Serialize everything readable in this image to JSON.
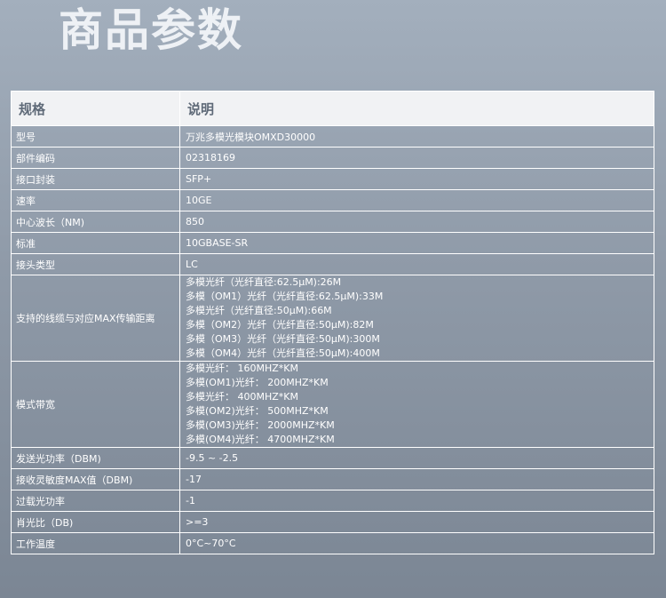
{
  "page_title": "商品参数",
  "table": {
    "headers": [
      "规格",
      "说明"
    ],
    "rows": [
      {
        "label": "型号",
        "value": "万兆多模光模块OMXD30000"
      },
      {
        "label": "部件编码",
        "value": "02318169"
      },
      {
        "label": "接口封装",
        "value": "SFP+"
      },
      {
        "label": "速率",
        "value": "10GE"
      },
      {
        "label": "中心波长（NM)",
        "value": "850"
      },
      {
        "label": "标准",
        "value": "10GBASE-SR"
      },
      {
        "label": "接头类型",
        "value": "LC"
      },
      {
        "label": "支持的线缆与对应MAX传输距离",
        "lines": [
          "多模光纤（光纤直径:62.5μM):26M",
          "多模（OM1）光纤（光纤直径:62.5μM):33M",
          "多模光纤（光纤直径:50μM):66M",
          "多模（OM2）光纤（光纤直径:50μM):82M",
          "多模（OM3）光纤（光纤直径:50μM):300M",
          "多模（OM4）光纤（光纤直径:50μM):400M"
        ]
      },
      {
        "label": "模式带宽",
        "lines": [
          "多模光纤： 160MHZ*KM",
          "多模(OM1)光纤： 200MHZ*KM",
          "多模光纤： 400MHZ*KM",
          "多模(OM2)光纤： 500MHZ*KM",
          "多模(OM3)光纤： 2000MHZ*KM",
          "多模(OM4)光纤： 4700MHZ*KM"
        ]
      },
      {
        "label": "发送光功率（DBM)",
        "value": "-9.5 ~ -2.5"
      },
      {
        "label": "接收灵敏度MAX值（DBM)",
        "value": "-17"
      },
      {
        "label": "过载光功率",
        "value": "-1"
      },
      {
        "label": "肖光比（DB)",
        "value": ">=3"
      },
      {
        "label": "工作温度",
        "value": "0°C~70°C"
      }
    ]
  }
}
